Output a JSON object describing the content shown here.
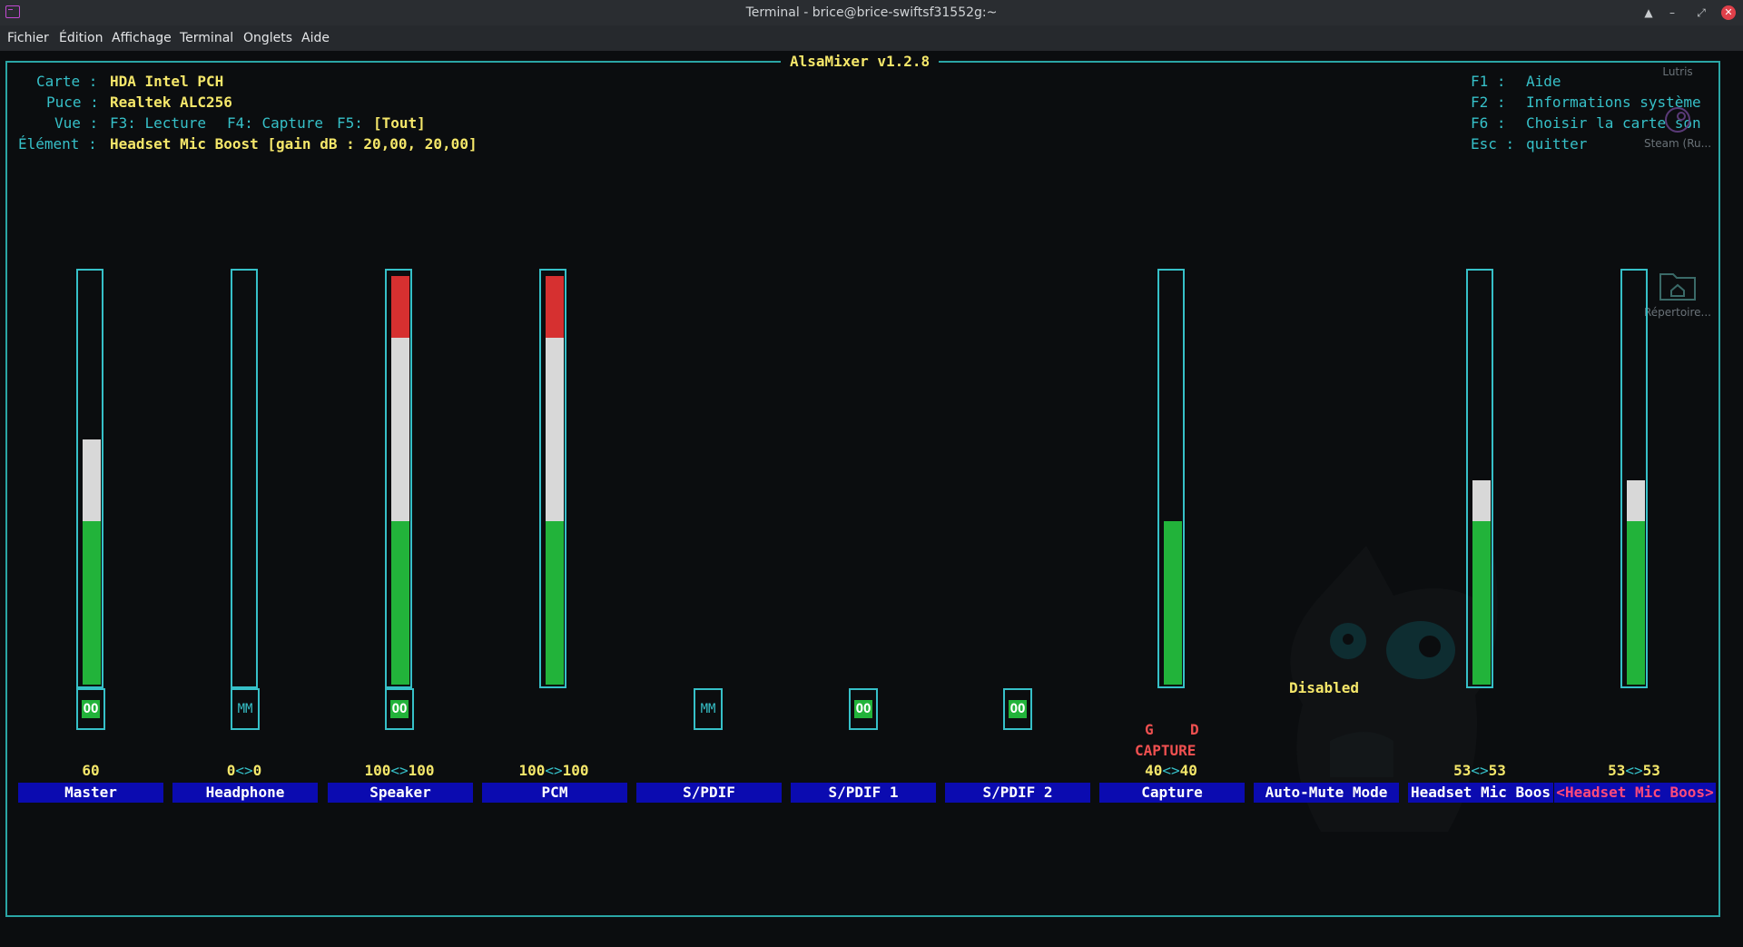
{
  "window": {
    "title": "Terminal - brice@brice-swiftsf31552g:~"
  },
  "menu": [
    "Fichier",
    "Édition",
    "Affichage",
    "Terminal",
    "Onglets",
    "Aide"
  ],
  "header_title": "AlsaMixer v1.2.8",
  "info": {
    "card_label": "Carte :",
    "card_value": "HDA Intel PCH",
    "chip_label": "Puce :",
    "chip_value": "Realtek ALC256",
    "view_label": "Vue :",
    "view_f3": "F3: Lecture",
    "view_f4": "F4: Capture",
    "view_f5": "F5:",
    "view_current": "[Tout]",
    "element_label": "Élément :",
    "element_value": "Headset Mic Boost [gain dB : 20,00, 20,00]"
  },
  "help": [
    {
      "key": "F1 :",
      "text": "Aide"
    },
    {
      "key": "F2 :",
      "text": "Informations système"
    },
    {
      "key": "F6 :",
      "text": "Choisir la carte son"
    },
    {
      "key": "Esc :",
      "text": "quitter"
    }
  ],
  "desktop_icons": [
    {
      "label": "Lutris"
    },
    {
      "label": "Steam (Ru..."
    },
    {
      "label": "Répertoire..."
    }
  ],
  "controls": [
    {
      "name": "Master",
      "volume_text": "60",
      "level": 0.6,
      "mute": "OO"
    },
    {
      "name": "Headphone",
      "volume_left": "0",
      "volume_right": "0",
      "level": 0.0,
      "mute": "MM"
    },
    {
      "name": "Speaker",
      "volume_left": "100",
      "volume_right": "100",
      "level": 1.0,
      "mute": "OO"
    },
    {
      "name": "PCM",
      "volume_left": "100",
      "volume_right": "100",
      "level": 1.0
    },
    {
      "name": "S/PDIF",
      "mute": "MM"
    },
    {
      "name": "S/PDIF 1",
      "mute": "OO"
    },
    {
      "name": "S/PDIF 2",
      "mute": "OO"
    },
    {
      "name": "Capture",
      "volume_left": "40",
      "volume_right": "40",
      "level": 0.4,
      "capture_left": "G",
      "capture_right": "D",
      "capture_text": "CAPTURE"
    },
    {
      "name": "Auto-Mute Mode",
      "enum_value": "Disabled"
    },
    {
      "name": "Headset Mic Boos",
      "volume_left": "53",
      "volume_right": "53",
      "level": 0.5
    },
    {
      "name": "Headset Mic Boos",
      "volume_left": "53",
      "volume_right": "53",
      "level": 0.5,
      "selected": true
    }
  ],
  "colors": {
    "frame": "#36c0c8",
    "green": "#22b33a",
    "white": "#d8d8d8",
    "red": "#d63030",
    "label_bg": "#0b0bb0",
    "text_yellow": "#f5e76a"
  }
}
